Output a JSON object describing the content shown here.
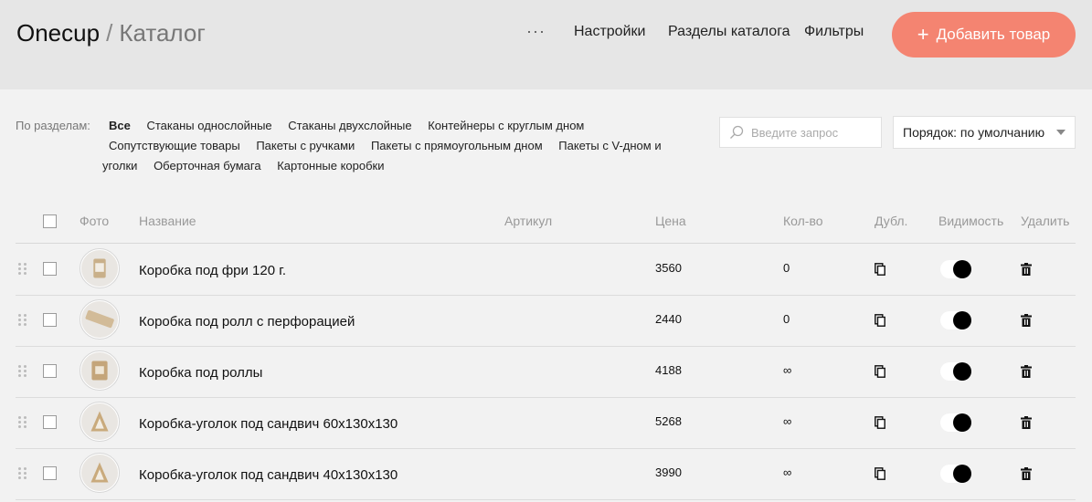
{
  "header": {
    "app_name": "Onecup",
    "separator": "/",
    "page_title": "Каталог",
    "more_label": "···",
    "nav": [
      "Настройки",
      "Разделы каталога",
      "Фильтры"
    ],
    "add_button": "Добавить товар",
    "add_icon": "+"
  },
  "colors": {
    "accent": "#f48471",
    "header_bg": "#e6e6e6",
    "page_bg": "#f2f2f2"
  },
  "filters": {
    "label": "По разделам:",
    "items": [
      "Все",
      "Стаканы однослойные",
      "Стаканы двухслойные",
      "Контейнеры с круглым дном",
      "Сопутствующие товары",
      "Пакеты с ручками",
      "Пакеты с прямоугольным дном",
      "Пакеты с V-дном и уголки",
      "Оберточная бумага",
      "Картонные коробки"
    ],
    "active": "Все"
  },
  "search": {
    "placeholder": "Введите запрос",
    "value": "",
    "icon": "search-icon"
  },
  "sort": {
    "label": "Порядок: по умолчанию"
  },
  "table": {
    "columns": {
      "photo": "Фото",
      "name": "Название",
      "sku": "Артикул",
      "price": "Цена",
      "qty": "Кол-во",
      "dup": "Дубл.",
      "visibility": "Видимость",
      "delete": "Удалить"
    },
    "rows": [
      {
        "name": "Коробка под фри 120 г.",
        "sku": "",
        "price": "3560",
        "qty": "0",
        "visible": true
      },
      {
        "name": "Коробка под ролл с перфорацией",
        "sku": "",
        "price": "2440",
        "qty": "0",
        "visible": true
      },
      {
        "name": "Коробка под роллы",
        "sku": "",
        "price": "4188",
        "qty": "∞",
        "visible": true
      },
      {
        "name": "Коробка-уголок под сандвич 60х130х130",
        "sku": "",
        "price": "5268",
        "qty": "∞",
        "visible": true
      },
      {
        "name": "Коробка-уголок под сандвич 40х130х130",
        "sku": "",
        "price": "3990",
        "qty": "∞",
        "visible": true
      }
    ]
  }
}
